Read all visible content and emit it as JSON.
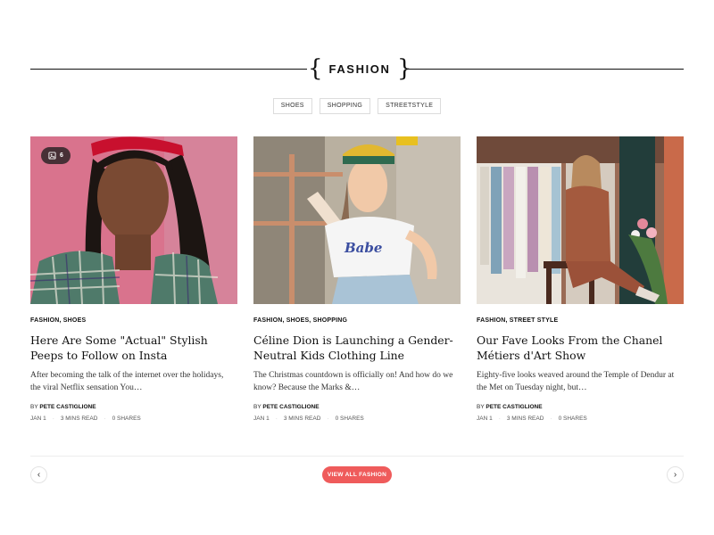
{
  "section": {
    "title": "FASHION"
  },
  "tags": [
    "SHOES",
    "SHOPPING",
    "STREETSTYLE"
  ],
  "articles": [
    {
      "gallery_count": "6",
      "categories": "FASHION, SHOES",
      "headline": "Here Are Some \"Actual\" Stylish Peeps to Follow on Insta",
      "excerpt": "After becoming the talk of the internet over the holidays, the viral Netflix sensation You…",
      "by": "BY",
      "author": "PETE CASTIGLIONE",
      "date": "JAN 1",
      "read_time": "3 MINS READ",
      "shares": "0 SHARES"
    },
    {
      "categories": "FASHION, SHOES, SHOPPING",
      "headline": "Céline Dion is Launching a Gender-Neutral Kids Clothing Line",
      "excerpt": "The Christmas countdown is officially on! And how do we know? Because the Marks &…",
      "by": "BY",
      "author": "PETE CASTIGLIONE",
      "date": "JAN 1",
      "read_time": "3 MINS READ",
      "shares": "0 SHARES"
    },
    {
      "categories": "FASHION, STREET STYLE",
      "headline": "Our Fave Looks From the Chanel Métiers d'Art Show",
      "excerpt": "Eighty-five looks weaved around the Temple of Dendur at the Met on Tuesday night, but…",
      "by": "BY",
      "author": "PETE CASTIGLIONE",
      "date": "JAN 1",
      "read_time": "3 MINS READ",
      "shares": "0 SHARES"
    }
  ],
  "footer": {
    "view_all_label": "VIEW ALL FASHION",
    "prev_glyph": "‹",
    "next_glyph": "›"
  },
  "colors": {
    "accent": "#ef5b5b",
    "text": "#111111",
    "rule": "#111111"
  },
  "icons": {
    "gallery": "gallery-icon",
    "prev": "chevron-left-icon",
    "next": "chevron-right-icon"
  }
}
